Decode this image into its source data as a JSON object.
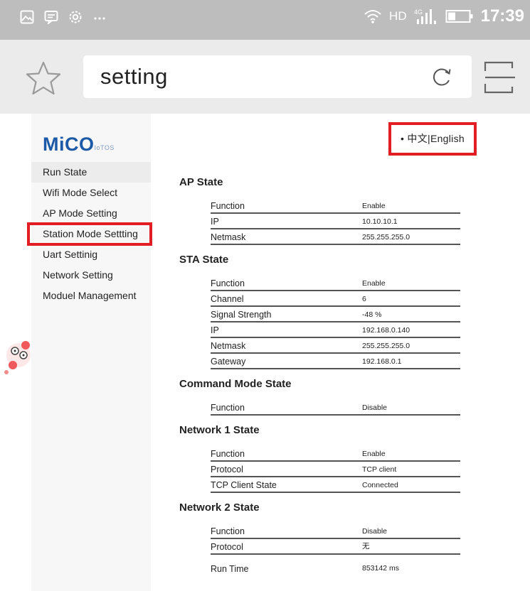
{
  "status_bar": {
    "time": "17:39",
    "network": "HD"
  },
  "browser": {
    "address_text": "setting"
  },
  "logo": {
    "name": "MiCO",
    "sub": "IoTOS"
  },
  "language": {
    "label": "• 中文|English"
  },
  "sidebar": {
    "items": [
      {
        "label": "Run State"
      },
      {
        "label": "Wifi Mode Select"
      },
      {
        "label": "AP Mode Setting"
      },
      {
        "label": "Station Mode Settting"
      },
      {
        "label": "Uart Settinig"
      },
      {
        "label": "Network Setting"
      },
      {
        "label": "Moduel Management"
      }
    ]
  },
  "sections": [
    {
      "title": "AP State",
      "rows": [
        {
          "key": "Function",
          "value": "Enable"
        },
        {
          "key": "IP",
          "value": "10.10.10.1"
        },
        {
          "key": "Netmask",
          "value": "255.255.255.0"
        }
      ]
    },
    {
      "title": "STA State",
      "rows": [
        {
          "key": "Function",
          "value": "Enable"
        },
        {
          "key": "Channel",
          "value": "6"
        },
        {
          "key": "Signal Strength",
          "value": "-48 %"
        },
        {
          "key": "IP",
          "value": "192.168.0.140"
        },
        {
          "key": "Netmask",
          "value": "255.255.255.0"
        },
        {
          "key": "Gateway",
          "value": "192.168.0.1"
        }
      ]
    },
    {
      "title": "Command Mode State",
      "rows": [
        {
          "key": "Function",
          "value": "Disable"
        }
      ]
    },
    {
      "title": "Network 1 State",
      "rows": [
        {
          "key": "Function",
          "value": "Enable"
        },
        {
          "key": "Protocol",
          "value": "TCP client"
        },
        {
          "key": "TCP Client State",
          "value": "Connected"
        }
      ]
    },
    {
      "title": "Network 2 State",
      "rows": [
        {
          "key": "Function",
          "value": "Disable"
        },
        {
          "key": "Protocol",
          "value": "无"
        }
      ]
    }
  ],
  "run_time": {
    "label": "Run Time",
    "value": "853142 ms"
  },
  "colors": {
    "highlight": "#e21d24",
    "logo": "#1c59a6",
    "status_bar": "#bdbdbd"
  }
}
